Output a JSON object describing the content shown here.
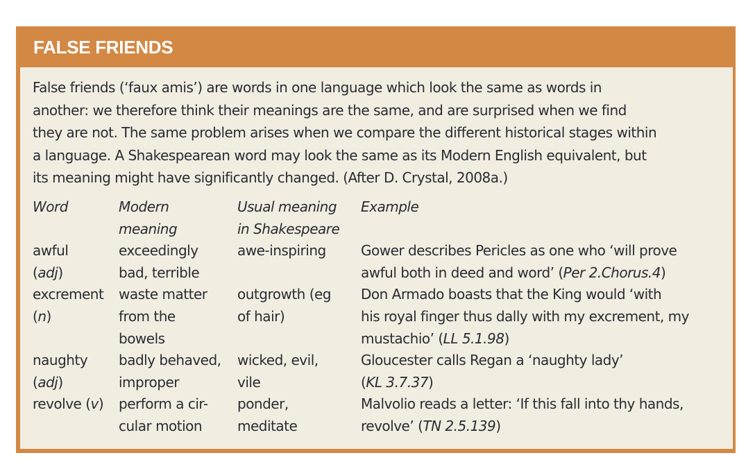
{
  "panel": {
    "title": "FALSE FRIENDS",
    "accent_color": "#d38844",
    "body_color": "#f1eee1",
    "intro_lines": [
      "False friends (‘faux amis’) are words in one language which look the same as words in",
      "another: we therefore think their meanings are the same, and are surprised when we find",
      "they are not. The same problem arises when we compare the different historical stages within",
      "a language. A Shakespearean word may look the same as its Modern English equivalent, but",
      "its meaning might have significantly changed. (After D. Crystal, 2008a.)"
    ]
  },
  "table": {
    "headers": {
      "word": [
        "Word"
      ],
      "modern": [
        "Modern",
        "meaning"
      ],
      "usual": [
        "Usual meaning",
        "in Shakespeare"
      ],
      "example": [
        "Example"
      ]
    },
    "rows": [
      {
        "word": "awful",
        "pos": "adj",
        "modern": [
          "exceedingly",
          "bad, terrible"
        ],
        "usual": [
          "awe-inspiring"
        ],
        "example": [
          {
            "text": "Gower describes Pericles as one who ‘will prove"
          },
          {
            "text": "awful both in deed and word’ (",
            "ref": "Per 2.Chorus.4",
            "after": ")"
          }
        ]
      },
      {
        "word": "excrement",
        "pos": "n",
        "modern": [
          "waste matter",
          "from the",
          "bowels"
        ],
        "usual": [
          "outgrowth (eg",
          "of hair)"
        ],
        "example": [
          {
            "text": "Don Armado boasts that the King would ‘with"
          },
          {
            "text": "his royal finger thus dally with my excrement, my"
          },
          {
            "text": "mustachio’ (",
            "ref": "LL 5.1.98",
            "after": ")"
          }
        ]
      },
      {
        "word": "naughty",
        "pos": "adj",
        "modern": [
          "badly behaved,",
          "improper"
        ],
        "usual": [
          "wicked, evil,",
          "vile"
        ],
        "example": [
          {
            "text": "Gloucester calls Regan a ‘naughty lady’"
          },
          {
            "text": "(",
            "ref": "KL 3.7.37",
            "after": ")"
          }
        ]
      },
      {
        "word": "revolve",
        "pos": "v",
        "modern": [
          "perform a cir-",
          "cular motion"
        ],
        "usual": [
          "ponder,",
          "meditate"
        ],
        "example": [
          {
            "text": "Malvolio reads a letter: ‘If this fall into thy hands,"
          },
          {
            "text": "revolve’ (",
            "ref": "TN 2.5.139",
            "after": ")"
          }
        ]
      }
    ]
  }
}
